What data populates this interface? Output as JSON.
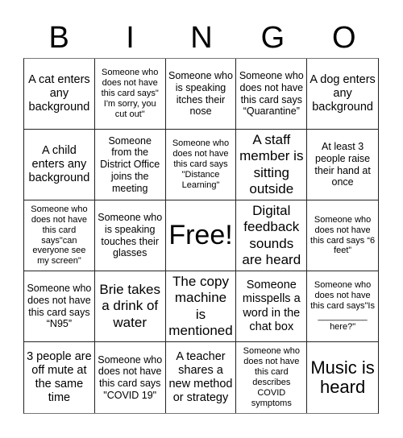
{
  "header": {
    "letters": [
      "B",
      "I",
      "N",
      "G",
      "O"
    ]
  },
  "cells": [
    "A cat enters any background",
    "Someone who does not have this card says\" I'm sorry, you cut out\"",
    "Someone who is speaking itches their nose",
    "Someone who does not have this card says “Quarantine”",
    "A dog enters any background",
    "A child enters any background",
    "Someone from the District Office joins the meeting",
    "Someone who does not have this card says \"Distance Learning\"",
    "A staff member is sitting outside",
    "At least 3 people raise their hand at once",
    "Someone who does not have this card says\"can everyone see my screen\"",
    "Someone who is speaking touches their glasses",
    "Free!",
    "Digital feedback sounds are heard",
    "Someone who does not have this card says “6 feet”",
    "Someone who does not have this card says “N95”",
    "Brie takes a drink of water",
    "The copy machine is mentioned",
    "Someone misspells a word in the chat box",
    "Someone who does not have this card says\"Is __________ here?\"",
    "3 people are off mute at the same time",
    "Someone who does not have this card says \"COVID 19\"",
    "A teacher shares a new method or strategy",
    "Someone who does not have this card describes COVID symptoms",
    "Music is heard"
  ]
}
